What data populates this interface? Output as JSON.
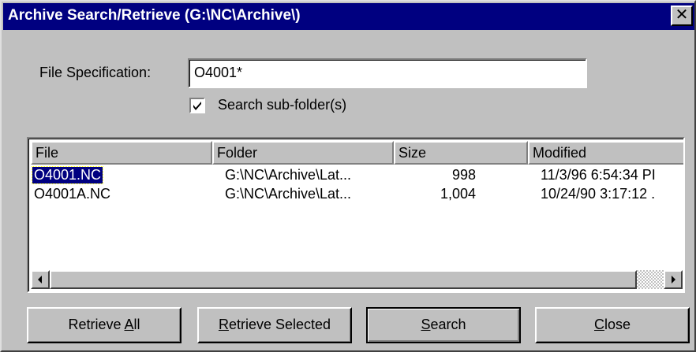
{
  "window": {
    "title": "Archive Search/Retrieve (G:\\NC\\Archive\\)",
    "close_label": "✕"
  },
  "form": {
    "file_spec_label": "File Specification:",
    "file_spec_value": "O4001*",
    "search_subfolders_label": "Search sub-folder(s)",
    "search_subfolders_checked": true
  },
  "list": {
    "columns": [
      "File",
      "Folder",
      "Size",
      "Modified"
    ],
    "rows": [
      {
        "file": "O4001.NC",
        "folder": "G:\\NC\\Archive\\Lat...",
        "size": "998",
        "modified": "11/3/96 6:54:34 PI",
        "selected": true
      },
      {
        "file": "O4001A.NC",
        "folder": "G:\\NC\\Archive\\Lat...",
        "size": "1,004",
        "modified": "10/24/90 3:17:12 .",
        "selected": false
      }
    ]
  },
  "buttons": {
    "retrieve_all": {
      "before": "Retrieve ",
      "accel": "A",
      "after": "ll"
    },
    "retrieve_selected": {
      "before": "",
      "accel": "R",
      "after": "etrieve Selected"
    },
    "search": {
      "before": "",
      "accel": "S",
      "after": "earch"
    },
    "close": {
      "before": "",
      "accel": "C",
      "after": "lose"
    }
  },
  "colors": {
    "titlebar": "#000080",
    "face": "#c0c0c0",
    "selection": "#000080"
  }
}
